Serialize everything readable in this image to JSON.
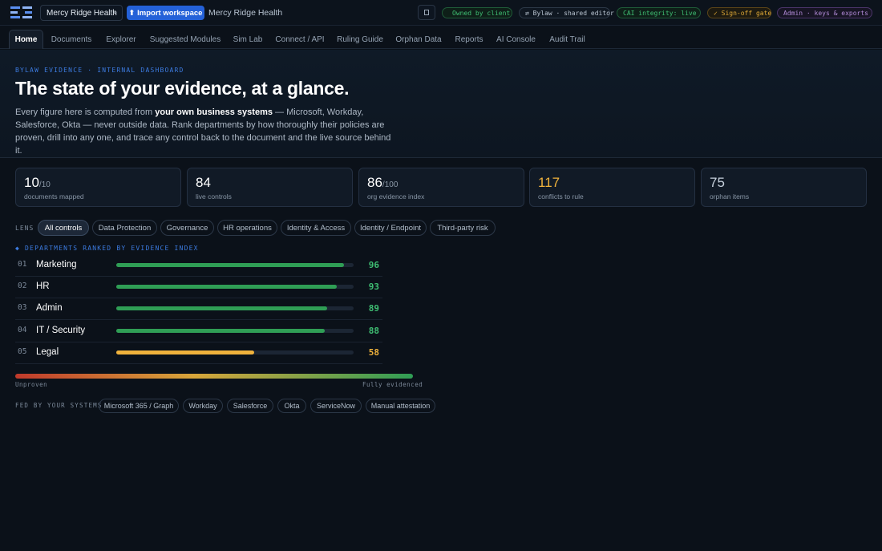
{
  "topbar": {
    "workspace_select": "Mercy Ridge Health",
    "import_label": "⬆ Import workspace",
    "org_name": "Mercy Ridge Health",
    "pills": {
      "owned": "Owned by client",
      "bylaw": "⇄ Bylaw · shared editor",
      "cai": "CAI integrity: live",
      "signoff": "✓ Sign-off gate",
      "admin": "Admin · keys & exports"
    }
  },
  "nav": {
    "tabs": [
      "Home",
      "Documents",
      "Explorer",
      "Suggested Modules",
      "Sim Lab",
      "Connect / API",
      "Ruling Guide",
      "Orphan Data",
      "Reports",
      "AI Console",
      "Audit Trail"
    ],
    "active": "Home"
  },
  "hero": {
    "eyebrow": "BYLAW EVIDENCE · INTERNAL DASHBOARD",
    "title": "The state of your evidence, at a glance.",
    "desc_pre": "Every figure here is computed from ",
    "desc_bold": "your own business systems",
    "desc_post": " — Microsoft, Workday, Salesforce, Okta — never outside data. Rank departments by how thoroughly their policies are proven, drill into any one, and trace any control back to the document and the live source behind it."
  },
  "stats": [
    {
      "value": "10",
      "suffix": "/10",
      "label": "documents mapped"
    },
    {
      "value": "84",
      "suffix": "",
      "label": "live controls"
    },
    {
      "value": "86",
      "suffix": "/100",
      "label": "org evidence index"
    },
    {
      "value": "117",
      "suffix": "",
      "label": "conflicts to rule"
    },
    {
      "value": "75",
      "suffix": "",
      "label": "orphan items"
    }
  ],
  "lens": {
    "label": "LENS",
    "chips": [
      "All controls",
      "Data Protection",
      "Governance",
      "HR operations",
      "Identity & Access",
      "Identity / Endpoint",
      "Third-party risk"
    ],
    "active": "All controls"
  },
  "ranking": {
    "title": "◆ DEPARTMENTS RANKED BY EVIDENCE INDEX",
    "rows": [
      {
        "rank": "01",
        "name": "Marketing",
        "score": 96
      },
      {
        "rank": "02",
        "name": "HR",
        "score": 93
      },
      {
        "rank": "03",
        "name": "Admin",
        "score": 89
      },
      {
        "rank": "04",
        "name": "IT / Security",
        "score": 88
      },
      {
        "rank": "05",
        "name": "Legal",
        "score": 58
      }
    ]
  },
  "scale": {
    "low": "Unproven",
    "high": "Fully evidenced"
  },
  "sources": {
    "label": "FED BY YOUR SYSTEMS",
    "chips": [
      "Microsoft 365 / Graph",
      "Workday",
      "Salesforce",
      "Okta",
      "ServiceNow",
      "Manual attestation"
    ]
  },
  "colors": {
    "accent": "#2461d8",
    "good": "#3fbf73",
    "warn": "#f0b23c",
    "bar_good": "#2f9e55",
    "bar_warn": "#f0b23c"
  }
}
